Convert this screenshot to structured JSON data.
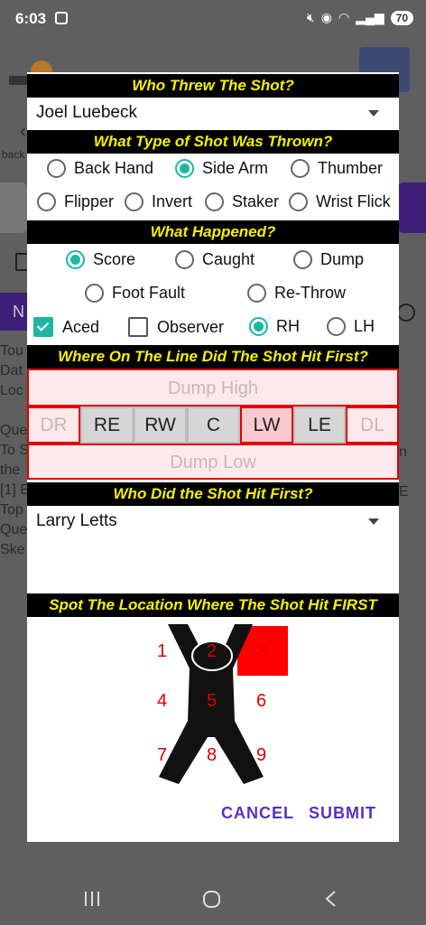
{
  "status": {
    "time": "6:03",
    "battery": "70"
  },
  "background": {
    "back_label": "back",
    "n_button": "N",
    "left_lines": [
      "Tou",
      "Dat",
      "Loc",
      "",
      "Que",
      "To S",
      "the",
      "[1] E",
      "Top",
      "Que",
      "Ske"
    ],
    "right_lines": [
      "n",
      "",
      "E"
    ]
  },
  "dialog": {
    "thrower_header": "Who Threw The Shot?",
    "thrower_value": "Joel Luebeck",
    "shot_type_header": "What Type of Shot Was Thrown?",
    "shot_types": [
      {
        "label": "Back Hand",
        "selected": false
      },
      {
        "label": "Side Arm",
        "selected": true
      },
      {
        "label": "Thumber",
        "selected": false
      },
      {
        "label": "Flipper",
        "selected": false
      },
      {
        "label": "Invert",
        "selected": false
      },
      {
        "label": "Staker",
        "selected": false
      },
      {
        "label": "Wrist Flick",
        "selected": false
      }
    ],
    "happened_header": "What Happened?",
    "outcomes": [
      {
        "label": "Score",
        "selected": true
      },
      {
        "label": "Caught",
        "selected": false
      },
      {
        "label": "Dump",
        "selected": false
      },
      {
        "label": "Foot Fault",
        "selected": false
      },
      {
        "label": "Re-Throw",
        "selected": false
      }
    ],
    "aced": {
      "label": "Aced",
      "checked": true
    },
    "observer": {
      "label": "Observer",
      "checked": false
    },
    "hands": [
      {
        "label": "RH",
        "selected": true
      },
      {
        "label": "LH",
        "selected": false
      }
    ],
    "line_header": "Where On The Line Did The Shot Hit First?",
    "dump_high": "Dump High",
    "dump_low": "Dump Low",
    "line_cells": [
      {
        "label": "DR",
        "state": "edge"
      },
      {
        "label": "RE",
        "state": "normal"
      },
      {
        "label": "RW",
        "state": "normal"
      },
      {
        "label": "C",
        "state": "normal"
      },
      {
        "label": "LW",
        "state": "selected"
      },
      {
        "label": "LE",
        "state": "normal"
      },
      {
        "label": "DL",
        "state": "edge"
      }
    ],
    "hit_header": "Who Did the Shot Hit First?",
    "hit_value": "Larry Letts",
    "spot_header": "Spot The Location Where The Shot Hit FIRST",
    "spot_numbers": [
      "1",
      "2",
      "3",
      "4",
      "5",
      "6",
      "7",
      "8",
      "9"
    ],
    "cancel_label": "CANCEL",
    "submit_label": "SUBMIT"
  },
  "colors": {
    "accent": "#1fb5a5",
    "header_bg": "#000000",
    "header_text": "#f5f000",
    "action": "#5b2fc0",
    "zone_red": "#e00000"
  }
}
